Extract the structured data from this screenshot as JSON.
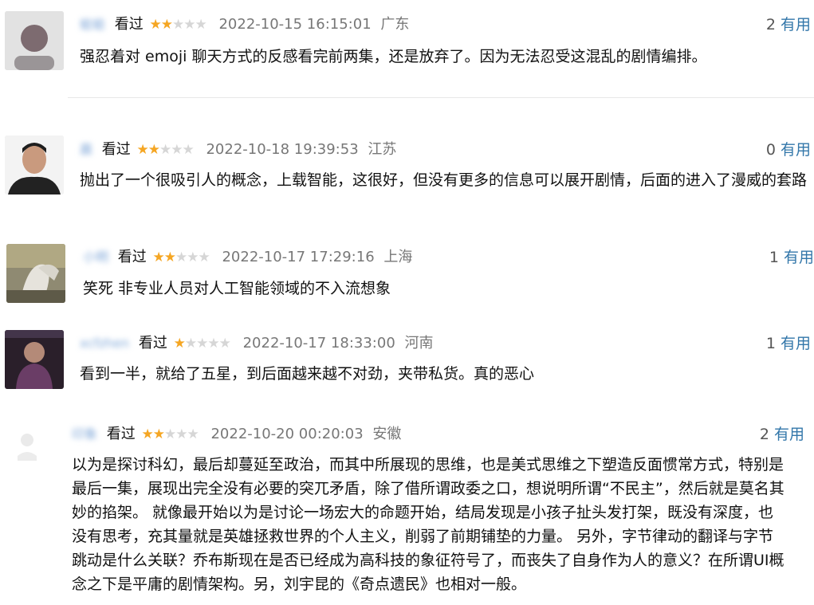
{
  "reviews": [
    {
      "username": "蛤蛤",
      "status": "看过",
      "rating": 2,
      "max_rating": 5,
      "time": "2022-10-15 16:15:01",
      "location": "广东",
      "useful_count": "2",
      "useful_label": "有用",
      "content": "强忍着对 emoji 聊天方式的反感看完前两集，还是放弃了。因为无法忍受这混乱的剧情编排。"
    },
    {
      "username": "晨",
      "status": "看过",
      "rating": 2,
      "max_rating": 5,
      "time": "2022-10-18 19:39:53",
      "location": "江苏",
      "useful_count": "0",
      "useful_label": "有用",
      "content": "抛出了一个很吸引人的概念，上载智能，这很好，但没有更多的信息可以展开剧情，后面的进入了漫威的套路"
    },
    {
      "username": "小明",
      "status": "看过",
      "rating": 2,
      "max_rating": 5,
      "time": "2022-10-17 17:29:16",
      "location": "上海",
      "useful_count": "1",
      "useful_label": "有用",
      "content": "笑死 非专业人员对人工智能领域的不入流想象"
    },
    {
      "username": "xcfzhen",
      "status": "看过",
      "rating": 1,
      "max_rating": 5,
      "time": "2022-10-17 18:33:00",
      "location": "河南",
      "useful_count": "1",
      "useful_label": "有用",
      "content": "看到一半，就给了五星，到后面越来越不对劲，夹带私货。真的恶心"
    },
    {
      "username": "印象",
      "status": "看过",
      "rating": 2,
      "max_rating": 5,
      "time": "2022-10-20 00:20:03",
      "location": "安徽",
      "useful_count": "2",
      "useful_label": "有用",
      "content_lines": [
        "以为是探讨科幻，最后却蔓延至政治，而其中所展现的思维，也是美式思维之下塑造反面惯常方式，特别是",
        "最后一集，展现出完全没有必要的突兀矛盾，除了借所谓政委之口，想说明所谓“不民主”，然后就是莫名其",
        "妙的掐架。 就像最开始以为是讨论一场宏大的命题开始，结局发现是小孩子扯头发打架，既没有深度，也",
        "没有思考，充其量就是英雄拯救世界的个人主义，削弱了前期铺垫的力量。 另外，字节律动的翻译与字节",
        "跳动是什么关联？乔布斯现在是否已经成为高科技的象征符号了，而丧失了自身作为人的意义？在所谓UI概",
        "念之下是平庸的剧情架构。另，刘宇昆的《奇点遗民》也相对一般。"
      ]
    }
  ]
}
